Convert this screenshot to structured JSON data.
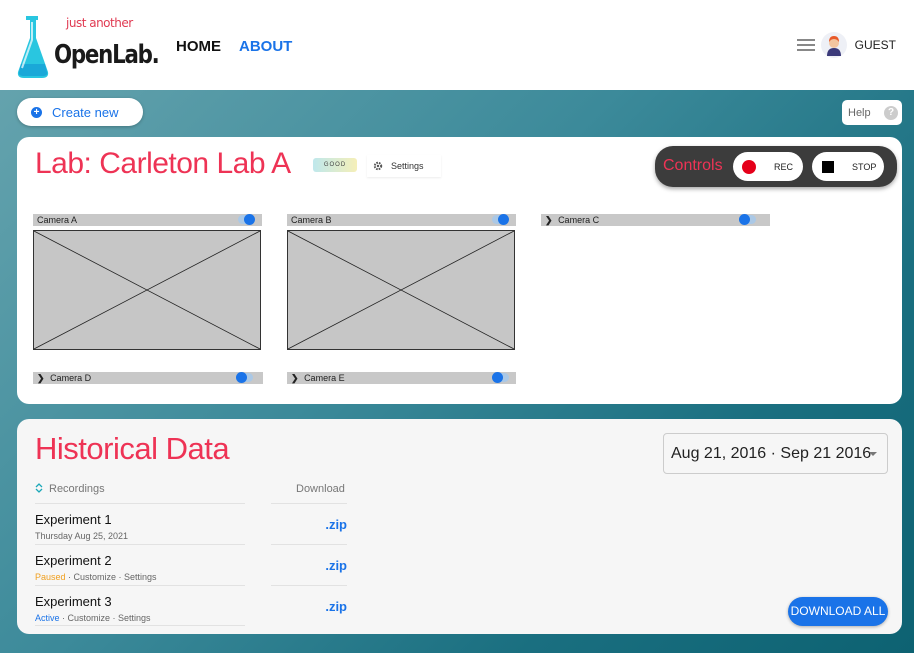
{
  "brand": {
    "tagline": "just another",
    "name": "OpenLab."
  },
  "nav": {
    "home": "HOME",
    "about": "ABOUT"
  },
  "user": {
    "name": "GUEST"
  },
  "toolbar": {
    "create_label": "Create new",
    "help_label": "Help"
  },
  "lab": {
    "title": "Lab: Carleton Lab A",
    "status": "GOOD",
    "settings_label": "Settings",
    "controls": {
      "label": "Controls",
      "rec_label": "REC",
      "stop_label": "STOP"
    },
    "cameras": [
      {
        "name": "Camera A",
        "expanded": true,
        "enabled": true
      },
      {
        "name": "Camera B",
        "expanded": true,
        "enabled": true
      },
      {
        "name": "Camera C",
        "expanded": false,
        "enabled": true
      },
      {
        "name": "Camera D",
        "expanded": false,
        "enabled": true
      },
      {
        "name": "Camera E",
        "expanded": false,
        "enabled": true
      }
    ]
  },
  "history": {
    "title": "Historical Data",
    "date_range": "Aug 21, 2016 · Sep 21 2016",
    "col_recordings": "Recordings",
    "col_download": "Download",
    "download_all": "DOWNLOAD ALL",
    "rows": [
      {
        "title": "Experiment 1",
        "sub": "Thursday Aug 25, 2021",
        "status": "",
        "download": ".zip"
      },
      {
        "title": "Experiment 2",
        "sub": " · Customize · Settings",
        "status": "Paused",
        "download": ".zip"
      },
      {
        "title": "Experiment 3",
        "sub": " · Customize · Settings",
        "status": "Active",
        "download": ".zip"
      }
    ]
  },
  "colors": {
    "accent": "#1a73e8",
    "title": "#ee3355",
    "rec": "#e5001a"
  }
}
